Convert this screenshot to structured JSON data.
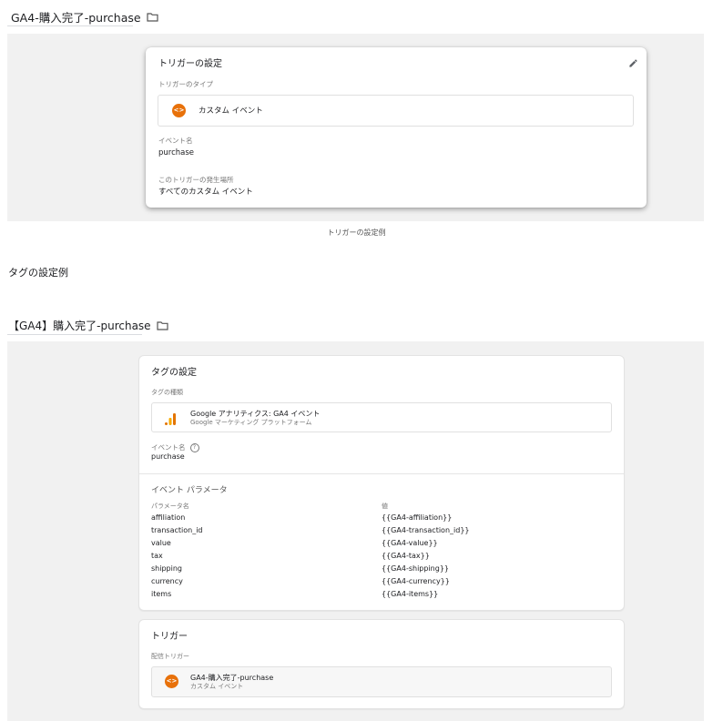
{
  "trigger_example": {
    "title": "GA4-購入完了-purchase",
    "card": {
      "heading": "トリガーの設定",
      "type_label": "トリガーのタイプ",
      "type_value": "カスタム イベント",
      "event_name_label": "イベント名",
      "event_name_value": "purchase",
      "fires_on_label": "このトリガーの発生場所",
      "fires_on_value": "すべてのカスタム イベント"
    },
    "caption": "トリガーの設定例"
  },
  "section_heading": "タグの設定例",
  "tag_example": {
    "title": "【GA4】購入完了-purchase",
    "tag_card": {
      "heading": "タグの設定",
      "type_label": "タグの種類",
      "type_title": "Google アナリティクス: GA4 イベント",
      "type_subtitle": "Google マーケティング プラットフォーム",
      "event_name_label": "イベント名",
      "event_name_value": "purchase",
      "params_heading": "イベント パラメータ",
      "params_col_name": "パラメータ名",
      "params_col_value": "値",
      "params": [
        {
          "name": "affiliation",
          "value": "{{GA4-affiliation}}"
        },
        {
          "name": "transaction_id",
          "value": "{{GA4-transaction_id}}"
        },
        {
          "name": "value",
          "value": "{{GA4-value}}"
        },
        {
          "name": "tax",
          "value": "{{GA4-tax}}"
        },
        {
          "name": "shipping",
          "value": "{{GA4-shipping}}"
        },
        {
          "name": "currency",
          "value": "{{GA4-currency}}"
        },
        {
          "name": "items",
          "value": "{{GA4-items}}"
        }
      ]
    },
    "trigger_card": {
      "heading": "トリガー",
      "firing_label": "配信トリガー",
      "trigger_name": "GA4-購入完了-purchase",
      "trigger_type": "カスタム イベント"
    }
  },
  "colors": {
    "accent_orange": "#e8710a",
    "ga_bar_dark": "#e37400",
    "ga_bar_light": "#f9ab00",
    "band_bg": "#f1f1f1"
  },
  "icons": [
    "folder-icon",
    "pencil-icon",
    "custom-event-icon",
    "analytics-icon",
    "help-icon"
  ]
}
